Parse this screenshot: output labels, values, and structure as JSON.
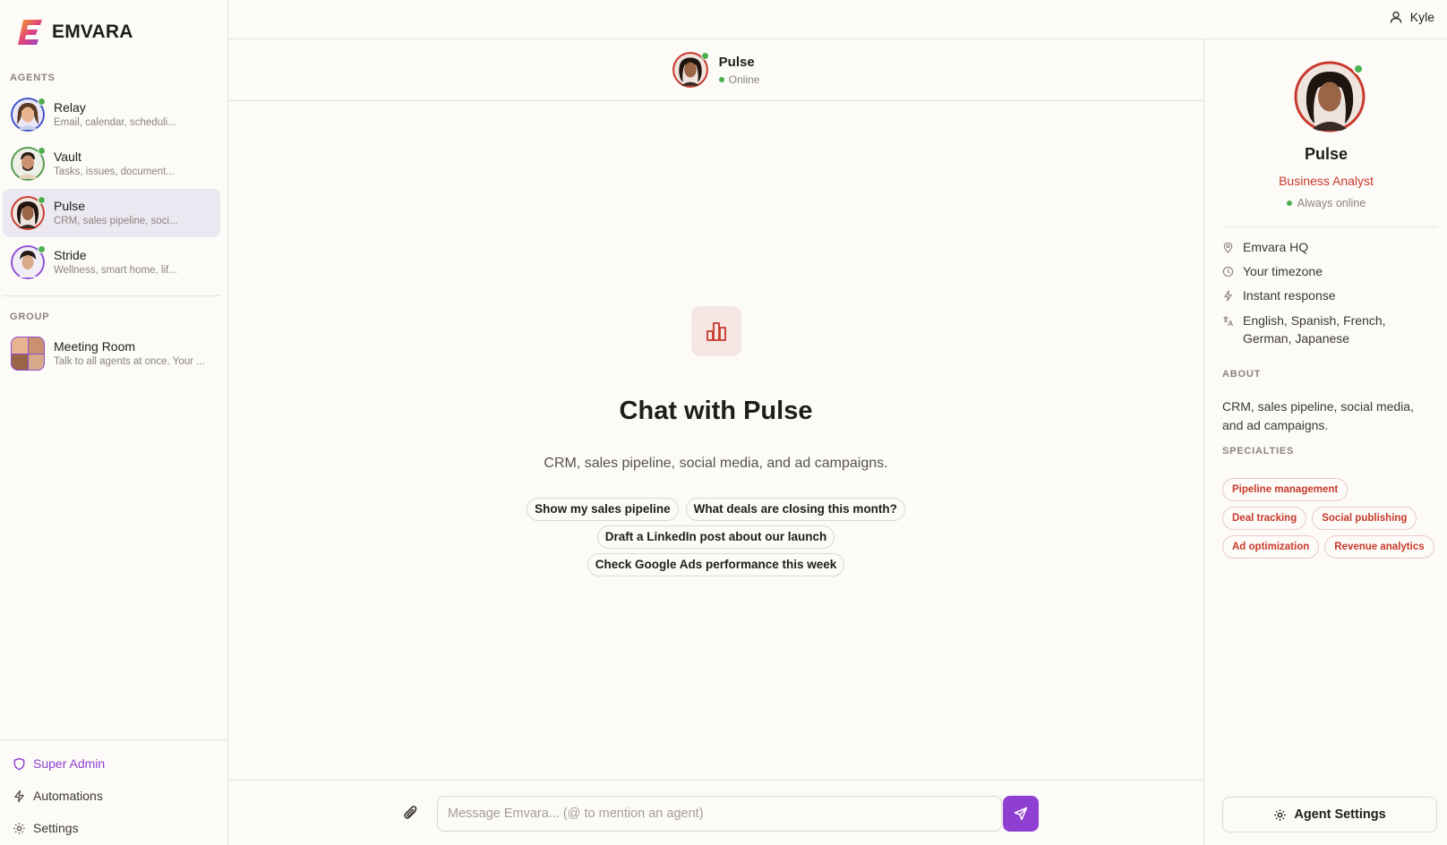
{
  "brand": {
    "name": "EMVARA"
  },
  "sidebar": {
    "agents_label": "AGENTS",
    "agents": [
      {
        "name": "Relay",
        "desc": "Email, calendar, scheduli...",
        "ring": "#3a4fc9"
      },
      {
        "name": "Vault",
        "desc": "Tasks, issues, document...",
        "ring": "#4c9a4a"
      },
      {
        "name": "Pulse",
        "desc": "CRM, sales pipeline, soci...",
        "ring": "#c8392b",
        "active": true
      },
      {
        "name": "Stride",
        "desc": "Wellness, smart home, lif...",
        "ring": "#8e4dd4"
      }
    ],
    "group_label": "GROUP",
    "group": {
      "name": "Meeting Room",
      "desc": "Talk to all agents at once. Your ..."
    },
    "footer": {
      "admin": "Super Admin",
      "automations": "Automations",
      "settings": "Settings"
    }
  },
  "topbar": {
    "user": "Kyle"
  },
  "chat": {
    "agent_name": "Pulse",
    "status": "Online",
    "title": "Chat with Pulse",
    "subtitle": "CRM, sales pipeline, social media, and ad campaigns.",
    "suggestions": [
      "Show my sales pipeline",
      "What deals are closing this month?",
      "Draft a LinkedIn post about our launch",
      "Check Google Ads performance this week"
    ],
    "input_placeholder": "Message Emvara... (@ to mention an agent)"
  },
  "profile": {
    "name": "Pulse",
    "role": "Business Analyst",
    "status": "Always online",
    "location": "Emvara HQ",
    "timezone": "Your timezone",
    "response": "Instant response",
    "languages": "English, Spanish, French, German, Japanese",
    "about_label": "ABOUT",
    "about": "CRM, sales pipeline, social media, and ad campaigns.",
    "specialties_label": "SPECIALTIES",
    "specialties": [
      "Pipeline management",
      "Deal tracking",
      "Social publishing",
      "Ad optimization",
      "Revenue analytics"
    ],
    "settings_button": "Agent Settings"
  },
  "colors": {
    "accent": "#8e3fd1",
    "brand_red": "#c8392b",
    "online": "#4caf50"
  }
}
